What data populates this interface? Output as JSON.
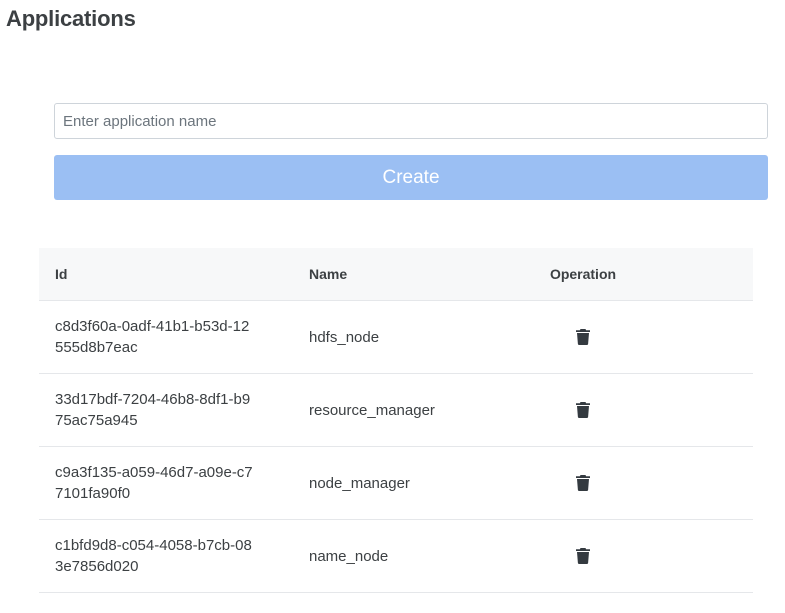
{
  "page": {
    "title": "Applications"
  },
  "form": {
    "input_placeholder": "Enter application name",
    "input_value": "",
    "create_label": "Create"
  },
  "table": {
    "headers": {
      "id": "Id",
      "name": "Name",
      "operation": "Operation"
    },
    "rows": [
      {
        "id": "c8d3f60a-0adf-41b1-b53d-12555d8b7eac",
        "name": "hdfs_node",
        "operation_icon": "trash-icon"
      },
      {
        "id": "33d17bdf-7204-46b8-8df1-b975ac75a945",
        "name": "resource_manager",
        "operation_icon": "trash-icon"
      },
      {
        "id": "c9a3f135-a059-46d7-a09e-c77101fa90f0",
        "name": "node_manager",
        "operation_icon": "trash-icon"
      },
      {
        "id": "c1bfd9d8-c054-4058-b7cb-083e7856d020",
        "name": "name_node",
        "operation_icon": "trash-icon"
      }
    ]
  },
  "colors": {
    "create_button_bg": "#9bbff3",
    "header_row_bg": "#f7f8f9",
    "text": "#3c4043"
  }
}
